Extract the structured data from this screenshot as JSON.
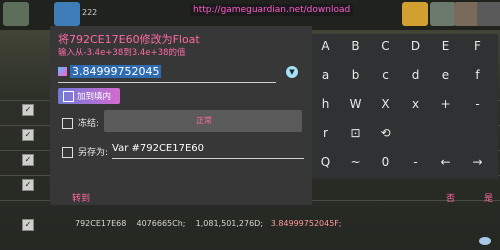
{
  "top": {
    "url": "http://gameguardian.net/download",
    "tile_text": "222"
  },
  "dialog": {
    "title": "将792CE17E60修改为Float",
    "hint": "输入从-3.4e+38到3.4e+38的值",
    "value": "3.84999752045",
    "add_to_list_label": "加到填内",
    "freeze_label": "冻结:",
    "freeze_status": "正常",
    "save_as_label": "另存为:",
    "save_as_value": "Var #792CE17E60"
  },
  "footer": {
    "goto_label": "转到",
    "no_label": "否",
    "yes_label": "是"
  },
  "status_row": {
    "address": "792CE17E68",
    "hex": "4076665Ch;",
    "numbers": "1,081,501,276D;",
    "float": "3.84999752045F;"
  },
  "keyboard": {
    "rows": [
      [
        "A",
        "B",
        "C",
        "D",
        "E",
        "F"
      ],
      [
        "a",
        "b",
        "c",
        "d",
        "e",
        "f"
      ],
      [
        "h",
        "W",
        "X",
        "x",
        "+",
        "-"
      ],
      [
        "r",
        "⊡",
        "⟲",
        "",
        "",
        ""
      ],
      [
        "Q",
        "~",
        "0",
        "-",
        "←",
        "→"
      ]
    ]
  },
  "colors": {
    "accent": "#ff6aa4",
    "url": "#ff5ad0",
    "dialog_bg": "#373737",
    "keyboard_bg": "#2f3233"
  }
}
